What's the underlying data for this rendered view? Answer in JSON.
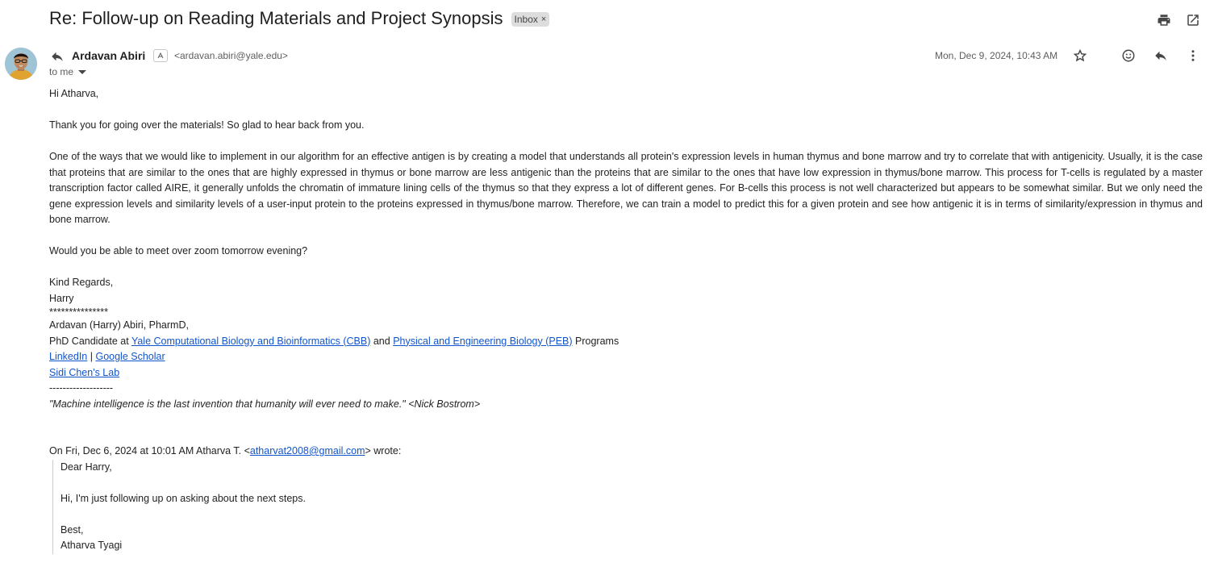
{
  "subject": "Re: Follow-up on Reading Materials and Project Synopsis",
  "label": {
    "text": "Inbox",
    "remove": "×"
  },
  "sender": {
    "name": "Ardavan Abiri",
    "email": "<ardavan.abiri@yale.edu>"
  },
  "recipient": "to me",
  "date": "Mon, Dec 9, 2024, 10:43 AM",
  "icons": {
    "print": "print-icon",
    "popout": "open-in-new-window-icon",
    "reply_arrow": "reply-icon",
    "star": "star-icon",
    "emoji": "emoji-icon",
    "more": "more-vertical-icon",
    "verified": "verified-sender-icon",
    "dropdown": "chevron-down-icon"
  },
  "body": {
    "greeting": "Hi Atharva,",
    "p1": "Thank you for going over the materials! So glad to hear back from you.",
    "p2": "One of the ways that we would like to implement in our algorithm for an effective antigen is by creating a model that understands all protein's expression levels in human thymus and bone marrow and try to correlate that with antigenicity. Usually, it is the case that proteins that are similar to the ones that are highly expressed in thymus or bone marrow are less antigenic than the proteins that are similar to the ones that have low expression in thymus/bone marrow. This process for T-cells is regulated by a master transcription factor called AIRE, it generally unfolds the chromatin of immature lining cells of the thymus so that they express a lot of different genes. For B-cells this process is not well characterized but appears to be somewhat similar. But we only need the gene expression levels and similarity levels of a user-input protein to the proteins expressed in thymus/bone marrow. Therefore, we can train a model to predict this for a given protein and see how antigenic it is in terms of similarity/expression in thymus and bone marrow.",
    "p3": "Would you be able to meet over zoom tomorrow evening?",
    "closing": "Kind Regards,",
    "name": "Harry"
  },
  "signature": {
    "stars": "***************",
    "full_name": "Ardavan (Harry) Abiri, PharmD,",
    "phd_prefix": "PhD Candidate at ",
    "program1": "Yale Computational Biology and Bioinformatics (CBB)",
    "and": " and ",
    "program2": "Physical and Engineering Biology (PEB)",
    "programs_suffix": " Programs",
    "linkedin": "LinkedIn",
    "separator": " | ",
    "scholar": "Google Scholar",
    "lab": "Sidi Chen's Lab",
    "dashes": "-------------------",
    "quote": "\"Machine intelligence is the last invention that humanity will ever need to make.\" <Nick Bostrom>"
  },
  "quoted": {
    "header_prefix": "On Fri, Dec 6, 2024 at 10:01 AM Atharva T. <",
    "header_email": "atharvat2008@gmail.com",
    "header_suffix": "> wrote:",
    "greeting": "Dear Harry,",
    "body": "Hi, I'm just following up on asking about the next steps.",
    "closing": "Best,",
    "name": "Atharva Tyagi"
  }
}
